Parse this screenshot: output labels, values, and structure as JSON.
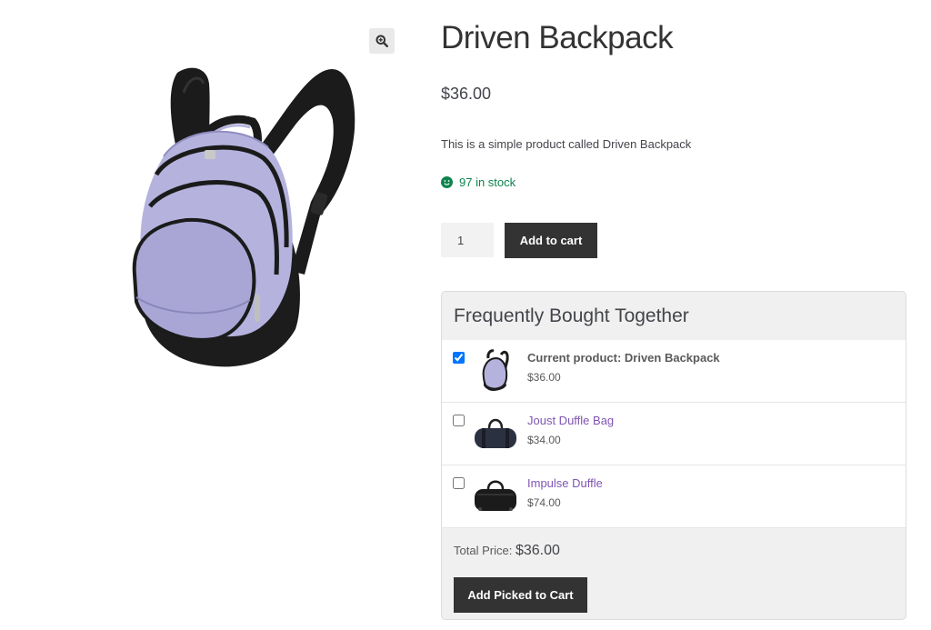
{
  "product": {
    "title": "Driven Backpack",
    "price": "$36.00",
    "description": "This is a simple product called Driven Backpack",
    "stock": "97 in stock",
    "quantity": "1",
    "add_to_cart_label": "Add to cart"
  },
  "gallery": {
    "zoom_icon": "magnifier-plus-icon",
    "image": "backpack-image"
  },
  "fbt": {
    "heading": "Frequently Bought Together",
    "items": [
      {
        "label": "Current product: Driven Backpack",
        "price": "$36.00",
        "checked": true,
        "thumb": "backpack-thumb"
      },
      {
        "label": "Joust Duffle Bag",
        "price": "$34.00",
        "checked": false,
        "thumb": "duffle-thumb"
      },
      {
        "label": "Impulse Duffle",
        "price": "$74.00",
        "checked": false,
        "thumb": "duffle-thumb"
      }
    ],
    "total_label": "Total Price:",
    "total_value": "$36.00",
    "add_picked_label": "Add Picked to Cart"
  },
  "colors": {
    "accent_link": "#7f54b3",
    "stock_green": "#0f834d",
    "button_dark": "#333333",
    "backpack_lavender": "#b5b3de"
  }
}
